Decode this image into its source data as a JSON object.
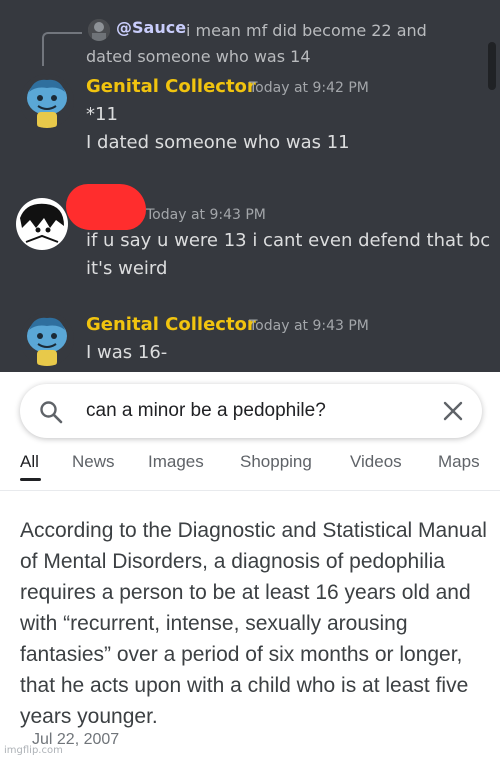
{
  "discord": {
    "colors": {
      "background": "#36393f",
      "username": "#f1c40f",
      "mention": "#c9cdfb",
      "redaction": "#ff2d2d"
    },
    "reply": {
      "mention": "@Sauce",
      "text": "i mean mf did become 22 and dated someone who was 14",
      "avatar_icon": "user-avatar-icon"
    },
    "messages": [
      {
        "author": "Genital Collector",
        "time": "Today at 9:42 PM",
        "lines": [
          "*11",
          "I dated someone who was 11"
        ]
      },
      {
        "author": "",
        "time": "Today at 9:43 PM",
        "lines": [
          "if u say u were 13 i cant even defend that bc",
          "it's weird"
        ]
      },
      {
        "author": "Genital Collector",
        "time": "Today at 9:43 PM",
        "lines": [
          "I was 16-"
        ]
      }
    ]
  },
  "google": {
    "search": {
      "query": "can a minor be a pedophile?",
      "search_icon": "search-icon",
      "clear_icon": "close-icon"
    },
    "tabs": [
      "All",
      "News",
      "Images",
      "Shopping",
      "Videos",
      "Maps"
    ],
    "active_tab": "All",
    "snippet": "According to the Diagnostic and Statistical Manual of Mental Disorders, a diagnosis of pedophilia requires a person to be at least 16 years old and with “recurrent, intense, sexually arousing fantasies” over a period of six months or longer, that he acts upon with a child who is at least five years younger.",
    "date": "Jul 22, 2007"
  },
  "watermark": "imgflip.com"
}
